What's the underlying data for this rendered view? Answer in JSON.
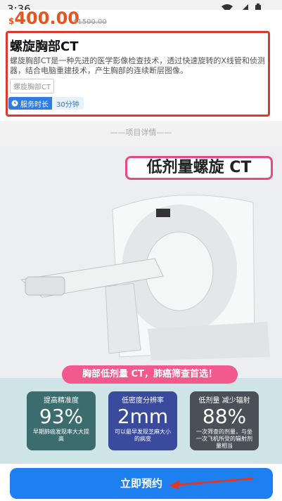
{
  "status": {
    "time": "3:36"
  },
  "product": {
    "currency": "$",
    "price": "400.00",
    "original_price": "$1500.00",
    "title": "螺旋胸部CT",
    "description": "螺旋胸部CT是一种先进的医学影像检查技术，透过快速旋转的X线管和侦测器，结合电脑重建技术，产生胸部的连续断层图像。",
    "tag": "螺旋胸部CT",
    "duration_label": "服务时长",
    "duration_value": "30分钟"
  },
  "section": {
    "title": "——项目详情——"
  },
  "detail_image": {
    "headline": "低剂量螺旋 CT",
    "banner": "胸部低剂量 CT，肺癌筛查首选！",
    "stats": [
      {
        "heading": "提高精准度",
        "number": "93%",
        "note": "早期肺癌发现率大大提高"
      },
      {
        "heading": "低密度分辨率",
        "number": "2mm",
        "note": "可以最早发现芝麻大小的病变"
      },
      {
        "heading": "低剂量 减少辐射",
        "number": "88%",
        "note": "一次筛查的剂量，与坐一次飞机所受的辐射剂量相当"
      }
    ]
  },
  "actions": {
    "book_label": "立即预约"
  },
  "colors": {
    "accent": "#1e7ff0",
    "price": "#e8541e",
    "highlight": "#d93b2b"
  }
}
